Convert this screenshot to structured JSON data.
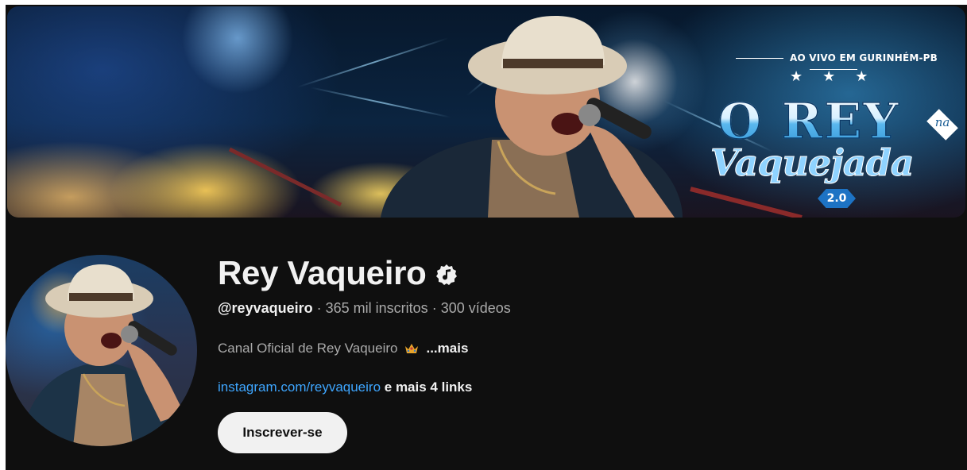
{
  "banner": {
    "live_label": "AO VIVO EM GURINHÉM-PB",
    "title_main": "O REY",
    "title_na": "na",
    "title_script": "Vaquejada",
    "version": "2.0"
  },
  "channel": {
    "name": "Rey Vaqueiro",
    "handle": "@reyvaqueiro",
    "subscribers": "365 mil inscritos",
    "videos": "300 vídeos",
    "separator": "·",
    "description": "Canal Oficial de Rey Vaqueiro",
    "description_emoji": "crown",
    "more_label": "...mais",
    "link_text": "instagram.com/reyvaqueiro",
    "more_links": "e mais 4 links",
    "verified_icon": "music-note-verified-icon"
  },
  "actions": {
    "subscribe_label": "Inscrever-se"
  },
  "colors": {
    "background": "#0f0f0f",
    "primary_text": "#f1f1f1",
    "secondary_text": "#aaaaaa",
    "link": "#3ea6ff",
    "button_bg": "#f1f1f1",
    "button_text": "#0f0f0f"
  }
}
